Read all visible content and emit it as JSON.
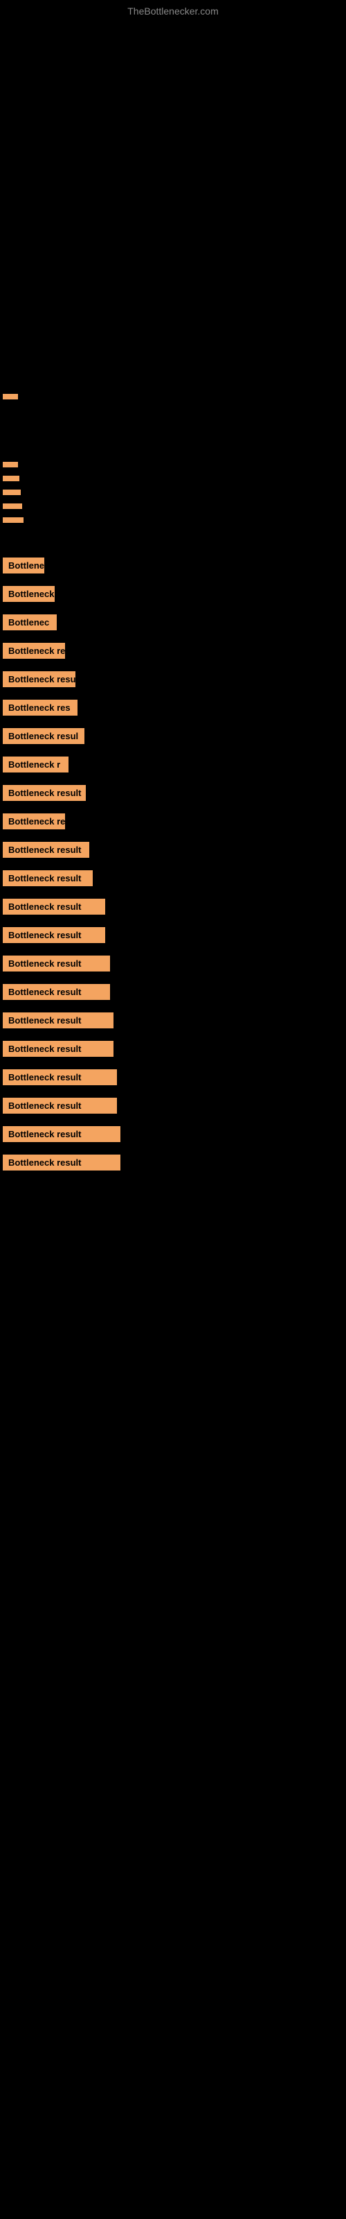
{
  "site": {
    "title": "TheBottlenecker.com"
  },
  "bars": [
    {
      "id": 1,
      "label": ""
    },
    {
      "id": 2,
      "label": ""
    },
    {
      "id": 3,
      "label": ""
    },
    {
      "id": 4,
      "label": ""
    },
    {
      "id": 5,
      "label": ""
    },
    {
      "id": 6,
      "label": ""
    },
    {
      "id": 7,
      "label": "Bottlene"
    },
    {
      "id": 8,
      "label": "Bottleneck r"
    },
    {
      "id": 9,
      "label": "Bottlenec"
    },
    {
      "id": 10,
      "label": "Bottleneck res"
    },
    {
      "id": 11,
      "label": "Bottleneck result"
    },
    {
      "id": 12,
      "label": "Bottleneck res"
    },
    {
      "id": 13,
      "label": "Bottleneck resul"
    },
    {
      "id": 14,
      "label": "Bottleneck r"
    },
    {
      "id": 15,
      "label": "Bottleneck result"
    },
    {
      "id": 16,
      "label": "Bottleneck res"
    },
    {
      "id": 17,
      "label": "Bottleneck result"
    },
    {
      "id": 18,
      "label": "Bottleneck result"
    },
    {
      "id": 19,
      "label": "Bottleneck result"
    },
    {
      "id": 20,
      "label": "Bottleneck result"
    },
    {
      "id": 21,
      "label": "Bottleneck result"
    },
    {
      "id": 22,
      "label": "Bottleneck result"
    },
    {
      "id": 23,
      "label": "Bottleneck result"
    },
    {
      "id": 24,
      "label": "Bottleneck result"
    },
    {
      "id": 25,
      "label": "Bottleneck result"
    },
    {
      "id": 26,
      "label": "Bottleneck result"
    },
    {
      "id": 27,
      "label": "Bottleneck result"
    },
    {
      "id": 28,
      "label": "Bottleneck result"
    }
  ]
}
